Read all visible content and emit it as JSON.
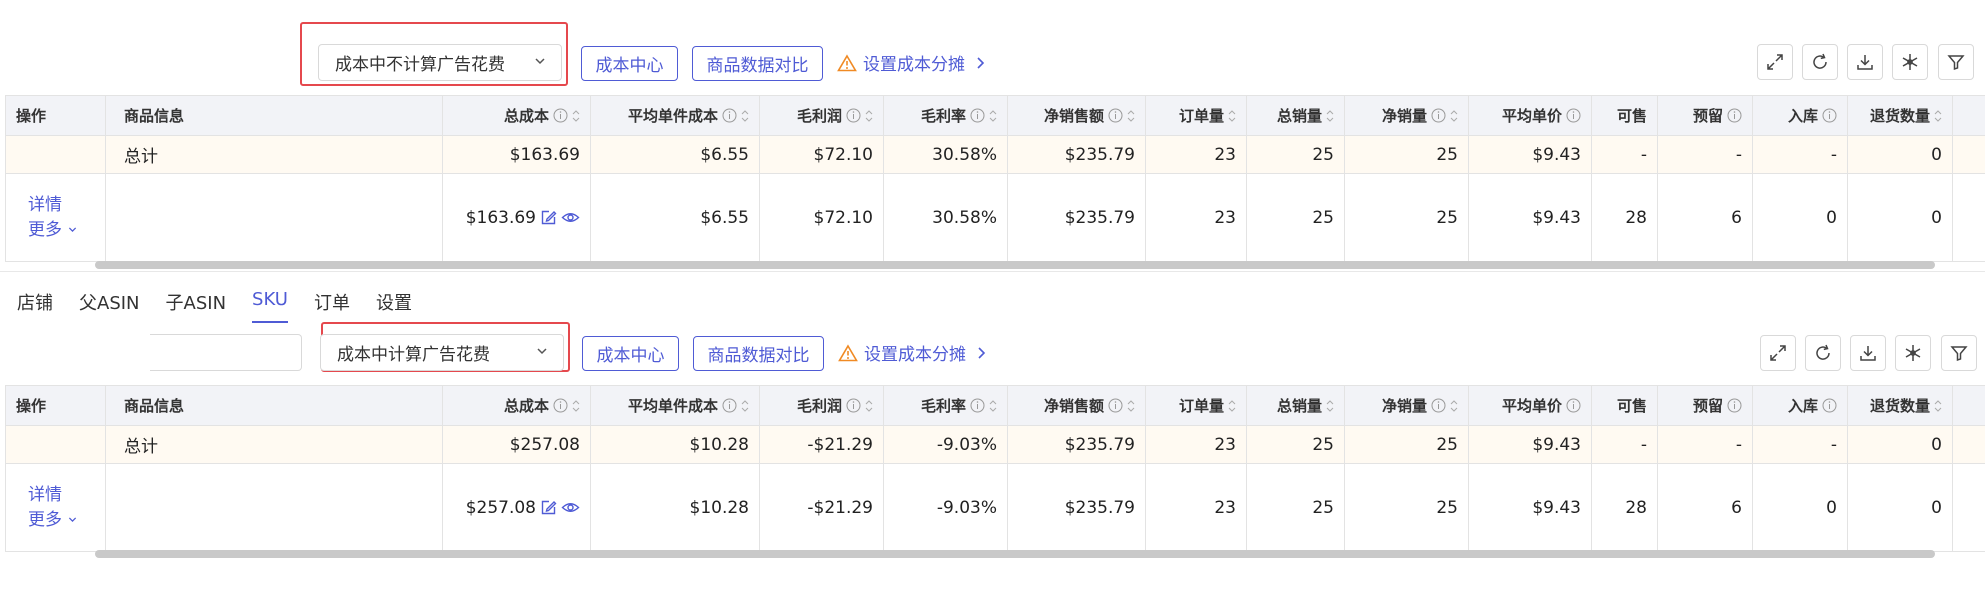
{
  "toolbar1": {
    "select_value": "成本中不计算广告花费",
    "cost_center": "成本中心",
    "compare": "商品数据对比",
    "allocate": "设置成本分摊"
  },
  "toolbar2": {
    "select_value": "成本中计算广告花费",
    "cost_center": "成本中心",
    "compare": "商品数据对比",
    "allocate": "设置成本分摊"
  },
  "tabs": [
    {
      "label": "店铺"
    },
    {
      "label": "父ASIN"
    },
    {
      "label": "子ASIN"
    },
    {
      "label": "SKU"
    },
    {
      "label": "订单"
    },
    {
      "label": "设置"
    }
  ],
  "columns": [
    "操作",
    "商品信息",
    "总成本",
    "平均单件成本",
    "毛利润",
    "毛利率",
    "净销售额",
    "订单量",
    "总销量",
    "净销量",
    "平均单价",
    "可售",
    "预留",
    "入库",
    "退货数量"
  ],
  "table1": {
    "total_label": "总计",
    "total": {
      "cost": "$163.69",
      "unit_cost": "$6.55",
      "profit": "$72.10",
      "margin": "30.58%",
      "sales": "$235.79",
      "orders": "23",
      "units": "25",
      "net_units": "25",
      "avg_price": "$9.43",
      "sellable": "-",
      "reserved": "-",
      "inbound": "-",
      "returns": "0"
    },
    "row": {
      "detail": "详情",
      "more": "更多",
      "cost": "$163.69",
      "unit_cost": "$6.55",
      "profit": "$72.10",
      "margin": "30.58%",
      "sales": "$235.79",
      "orders": "23",
      "units": "25",
      "net_units": "25",
      "avg_price": "$9.43",
      "sellable": "28",
      "reserved": "6",
      "inbound": "0",
      "returns": "0"
    }
  },
  "table2": {
    "total_label": "总计",
    "total": {
      "cost": "$257.08",
      "unit_cost": "$10.28",
      "profit": "-$21.29",
      "margin": "-9.03%",
      "sales": "$235.79",
      "orders": "23",
      "units": "25",
      "net_units": "25",
      "avg_price": "$9.43",
      "sellable": "-",
      "reserved": "-",
      "inbound": "-",
      "returns": "0"
    },
    "row": {
      "detail": "详情",
      "more": "更多",
      "cost": "$257.08",
      "unit_cost": "$10.28",
      "profit": "-$21.29",
      "margin": "-9.03%",
      "sales": "$235.79",
      "orders": "23",
      "units": "25",
      "net_units": "25",
      "avg_price": "$9.43",
      "sellable": "28",
      "reserved": "6",
      "inbound": "0",
      "returns": "0"
    }
  },
  "colors": {
    "accent": "#4f5bd5",
    "negative": "#e5484d",
    "highlight_frame": "#e5484d"
  }
}
